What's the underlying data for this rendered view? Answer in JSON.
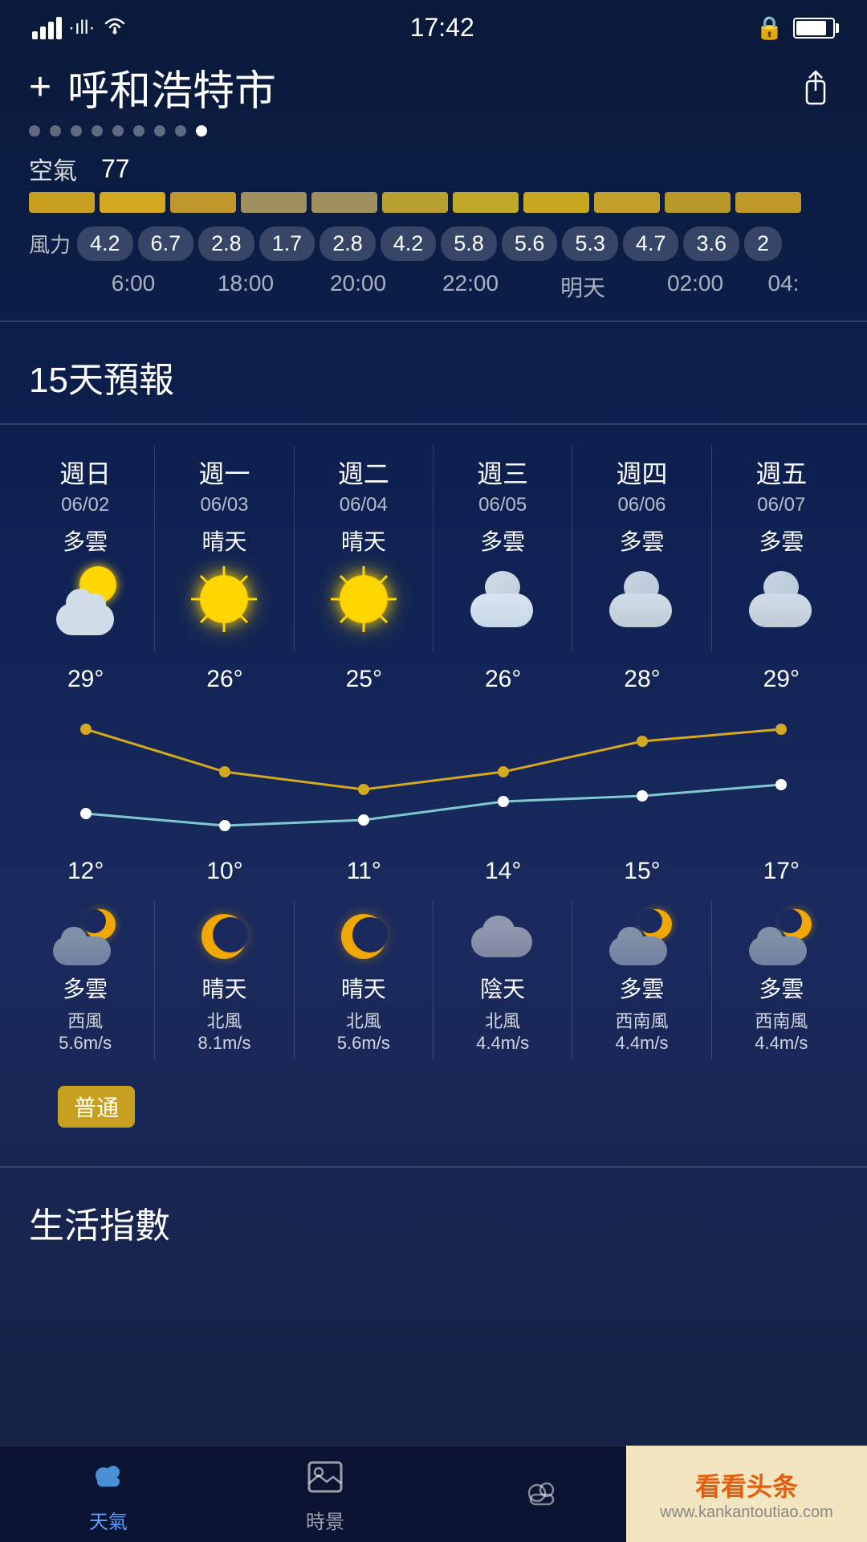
{
  "statusBar": {
    "time": "17:42"
  },
  "header": {
    "plusLabel": "+",
    "cityName": "呼和浩特市",
    "shareIcon": "⬆"
  },
  "pageDots": [
    true,
    false,
    false,
    false,
    false,
    false,
    false,
    false,
    true
  ],
  "airQuality": {
    "label": "空氣",
    "value": "77"
  },
  "windForce": {
    "label": "風力",
    "values": [
      "4.2",
      "6.7",
      "2.8",
      "1.7",
      "2.8",
      "4.2",
      "5.8",
      "5.6",
      "5.3",
      "4.7",
      "3.6",
      "2"
    ]
  },
  "timeLabels": [
    "6:00",
    "18:00",
    "20:00",
    "22:00",
    "明天",
    "02:00",
    "04:"
  ],
  "forecastHeader": "15天預報",
  "forecast": [
    {
      "weekday": "週日",
      "date": "06/02",
      "condition": "多雲",
      "iconType": "partly-cloudy",
      "highTemp": "29°",
      "lowTemp": "12°",
      "nightCondition": "多雲",
      "nightIcon": "night-cloud",
      "windDir": "西風",
      "windSpeed": "5.6m/s"
    },
    {
      "weekday": "週一",
      "date": "06/03",
      "condition": "晴天",
      "iconType": "sunny",
      "highTemp": "26°",
      "lowTemp": "10°",
      "nightCondition": "晴天",
      "nightIcon": "night-moon",
      "windDir": "北風",
      "windSpeed": "8.1m/s"
    },
    {
      "weekday": "週二",
      "date": "06/04",
      "condition": "晴天",
      "iconType": "sunny",
      "highTemp": "25°",
      "lowTemp": "11°",
      "nightCondition": "晴天",
      "nightIcon": "night-moon",
      "windDir": "北風",
      "windSpeed": "5.6m/s"
    },
    {
      "weekday": "週三",
      "date": "06/05",
      "condition": "多雲",
      "iconType": "cloudy",
      "highTemp": "26°",
      "lowTemp": "14°",
      "nightCondition": "陰天",
      "nightIcon": "night-overcast",
      "windDir": "北風",
      "windSpeed": "4.4m/s"
    },
    {
      "weekday": "週四",
      "date": "06/06",
      "condition": "多雲",
      "iconType": "cloudy",
      "highTemp": "28°",
      "lowTemp": "15°",
      "nightCondition": "多雲",
      "nightIcon": "night-cloud",
      "windDir": "西南風",
      "windSpeed": "4.4m/s"
    },
    {
      "weekday": "週五",
      "date": "06/07",
      "condition": "多雲",
      "iconType": "cloudy",
      "highTemp": "29°",
      "lowTemp": "17°",
      "nightCondition": "多雲",
      "nightIcon": "night-cloud",
      "windDir": "西南風",
      "windSpeed": "4.4m/s"
    }
  ],
  "qualityBadge": "普通",
  "lifeIndexHeader": "生活指數",
  "bottomNav": [
    {
      "label": "天氣",
      "active": true,
      "icon": "cloud"
    },
    {
      "label": "時景",
      "active": false,
      "icon": "image"
    },
    {
      "label": "",
      "active": false,
      "icon": "cloud2"
    },
    {
      "label": "",
      "active": false,
      "icon": "location"
    }
  ],
  "watermark": {
    "line1": "看看头条",
    "line2": "www.kankantoutiao.com"
  }
}
